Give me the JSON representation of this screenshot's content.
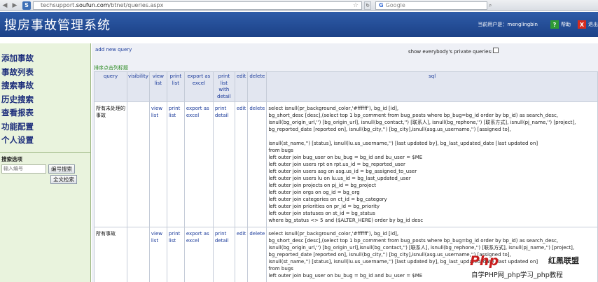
{
  "browser": {
    "url_prefix": "techsupport.",
    "url_domain": "soufun.com",
    "url_path": "/btnet/queries.aspx",
    "search_placeholder": "Google",
    "site_icon_letter": "S"
  },
  "header": {
    "title": "搜房事故管理系统",
    "user_label": "当前用户是：menglingbin",
    "help_label": "帮助",
    "help_icon_text": "?",
    "exit_label": "退出",
    "exit_icon_text": "X"
  },
  "sidebar": {
    "items": [
      {
        "label": "添加事故"
      },
      {
        "label": "事故列表"
      },
      {
        "label": "搜索事故"
      },
      {
        "label": "历史搜索"
      },
      {
        "label": "查看报表"
      },
      {
        "label": "功能配置"
      },
      {
        "label": "个人设置"
      }
    ],
    "search_title": "搜索选项",
    "search_placeholder": "输入编号",
    "search_by_id_label": "编号搜索",
    "fulltext_search_label": "全文检索"
  },
  "main": {
    "add_query_label": "add new query",
    "private_queries_label": "show everybody's private queries:",
    "sort_hint": "排序点击列标题",
    "columns": {
      "query": "query",
      "visibility": "visibility",
      "view_list": [
        "view",
        "list"
      ],
      "print_list": [
        "print",
        "list"
      ],
      "export_excel": [
        "export as",
        "excel"
      ],
      "print_detail": [
        "print",
        "list",
        "with",
        "detail"
      ],
      "edit": "edit",
      "delete": "delete",
      "sql": "sql"
    },
    "rows": [
      {
        "name": "所有未处理的事故",
        "visibility": "",
        "view_list": "view list",
        "print_list": "print list",
        "export_excel": "export as excel",
        "print_detail": "print detail",
        "edit": "edit",
        "delete": "delete",
        "sql": [
          "select isnull(pr_background_color,'#ffffff'), bg_id [id],",
          "bg_short_desc [desc],(select top 1 bp_comment from bug_posts where bp_bug=bg_id order by bp_id) as search_desc,",
          "isnull(bg_origin_url,'') [bg_origin_url], isnull(bg_contact,'') [联系人], isnull(bg_rephone,'') [联系方式], isnull(pj_name,'') [project],",
          "bg_reported_date [reported on], isnull(bg_city,'') [bg_city],isnull(asg.us_username,'') [assigned to],",
          "",
          "isnull(st_name,'') [status], isnull(lu.us_username,'') [last updated by], bg_last_updated_date [last updated on]",
          "from bugs",
          "left outer join bug_user on bu_bug = bg_id and bu_user = $ME",
          "left outer join users rpt on rpt.us_id = bg_reported_user",
          "left outer join users asg on asg.us_id = bg_assigned_to_user",
          "left outer join users lu on lu.us_id = bg_last_updated_user",
          "left outer join projects on pj_id = bg_project",
          "left outer join orgs on og_id = bg_org",
          "left outer join categories on ct_id = bg_category",
          "left outer join priorities on pr_id = bg_priority",
          "left outer join statuses on st_id = bg_status",
          "where bg_status <> 5 and ($ALTER_HERE) order by bg_id desc"
        ]
      },
      {
        "name": "所有事故",
        "visibility": "",
        "view_list": "view list",
        "print_list": "print list",
        "export_excel": "export as excel",
        "print_detail": "print detail",
        "edit": "edit",
        "delete": "delete",
        "sql": [
          "select isnull(pr_background_color,'#ffffff'), bg_id [id],",
          "bg_short_desc [desc],(select top 1 bp_comment from bug_posts where bp_bug=bg_id order by bp_id) as search_desc,",
          "isnull(bg_origin_url,'') [bg_origin_url],isnull(bg_contact,'') [联系人], isnull(bg_rephone,'') [联系方式], isnull(pj_name,'') [project],",
          "bg_reported_date [reported on], isnull(bg_city,'') [bg_city],isnull(asg.us_username,'') [assigned to],",
          "isnull(st_name,'') [status], isnull(lu.us_username,'') [last updated by], bg_last_updated_date [last updated on]",
          "from bugs",
          "left outer join bug_user on bu_bug = bg_id and bu_user = $ME"
        ]
      }
    ]
  },
  "watermark": {
    "logo_text": "Php",
    "logo_right": "红黑联盟",
    "caption": "自学PHP网_php学习_php教程"
  },
  "colors": {
    "header_bg": "#1c4187",
    "sidebar_bg": "#e9f3dd",
    "sort_hint": "#2a8a20",
    "link": "#1a3a9a"
  }
}
